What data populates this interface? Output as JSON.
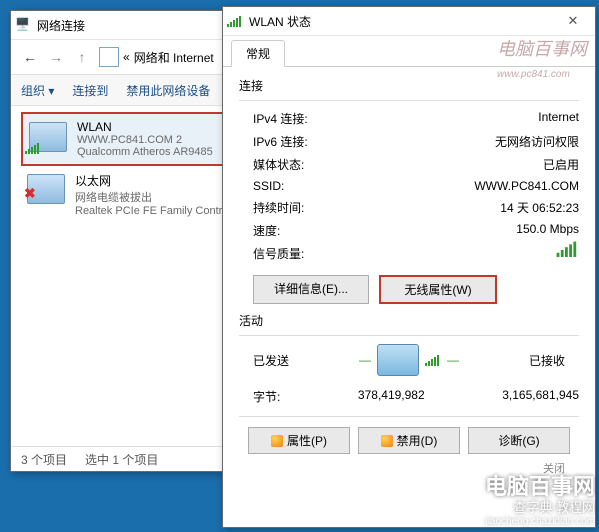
{
  "nc": {
    "title": "网络连接",
    "breadcrumb_prefix": "«",
    "breadcrumb": "网络和 Internet",
    "cmd_org": "组织 ▾",
    "cmd_connect": "连接到",
    "cmd_disable": "禁用此网络设备",
    "items": [
      {
        "name": "WLAN",
        "line2": "WWW.PC841.COM  2",
        "line3": "Qualcomm Atheros AR9485",
        "selected": true,
        "signal": true
      },
      {
        "name": "以太网",
        "line2": "网络电缆被拔出",
        "line3": "Realtek PCIe FE Family Contr",
        "selected": false,
        "disabled": true
      }
    ],
    "status_count": "3 个项目",
    "status_sel": "选中 1 个项目"
  },
  "ws": {
    "title": "WLAN 状态",
    "tab": "常规",
    "watermark": "电脑百事网",
    "watermark_sub": "www.pc841.com",
    "sect_conn": "连接",
    "rows_conn": [
      {
        "k": "IPv4 连接:",
        "v": "Internet"
      },
      {
        "k": "IPv6 连接:",
        "v": "无网络访问权限"
      },
      {
        "k": "媒体状态:",
        "v": "已启用"
      },
      {
        "k": "SSID:",
        "v": "WWW.PC841.COM"
      },
      {
        "k": "持续时间:",
        "v": "14 天 06:52:23"
      },
      {
        "k": "速度:",
        "v": "150.0 Mbps"
      }
    ],
    "sigq": "信号质量:",
    "btn_details": "详细信息(E)...",
    "btn_wprops": "无线属性(W)",
    "sect_act": "活动",
    "act_sent": "已发送",
    "act_recv": "已接收",
    "bytes_k": "字节:",
    "bytes_sent": "378,419,982",
    "bytes_recv": "3,165,681,945",
    "btn_props": "属性(P)",
    "btn_disable": "禁用(D)",
    "btn_diag": "诊断(G)",
    "btn_close": "关闭"
  },
  "overlay": {
    "l1": "电脑百事网",
    "l2": "查字典 教程网",
    "l3": "jiaocheng.chazidian.com"
  }
}
